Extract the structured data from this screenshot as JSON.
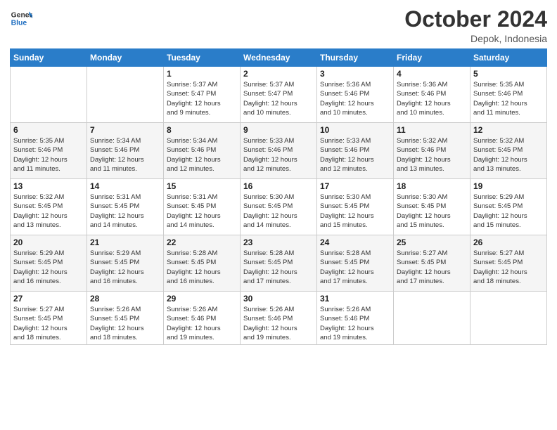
{
  "logo": {
    "line1": "General",
    "line2": "Blue"
  },
  "title": "October 2024",
  "location": "Depok, Indonesia",
  "days_header": [
    "Sunday",
    "Monday",
    "Tuesday",
    "Wednesday",
    "Thursday",
    "Friday",
    "Saturday"
  ],
  "weeks": [
    [
      {
        "day": "",
        "info": ""
      },
      {
        "day": "",
        "info": ""
      },
      {
        "day": "1",
        "info": "Sunrise: 5:37 AM\nSunset: 5:47 PM\nDaylight: 12 hours\nand 9 minutes."
      },
      {
        "day": "2",
        "info": "Sunrise: 5:37 AM\nSunset: 5:47 PM\nDaylight: 12 hours\nand 10 minutes."
      },
      {
        "day": "3",
        "info": "Sunrise: 5:36 AM\nSunset: 5:46 PM\nDaylight: 12 hours\nand 10 minutes."
      },
      {
        "day": "4",
        "info": "Sunrise: 5:36 AM\nSunset: 5:46 PM\nDaylight: 12 hours\nand 10 minutes."
      },
      {
        "day": "5",
        "info": "Sunrise: 5:35 AM\nSunset: 5:46 PM\nDaylight: 12 hours\nand 11 minutes."
      }
    ],
    [
      {
        "day": "6",
        "info": "Sunrise: 5:35 AM\nSunset: 5:46 PM\nDaylight: 12 hours\nand 11 minutes."
      },
      {
        "day": "7",
        "info": "Sunrise: 5:34 AM\nSunset: 5:46 PM\nDaylight: 12 hours\nand 11 minutes."
      },
      {
        "day": "8",
        "info": "Sunrise: 5:34 AM\nSunset: 5:46 PM\nDaylight: 12 hours\nand 12 minutes."
      },
      {
        "day": "9",
        "info": "Sunrise: 5:33 AM\nSunset: 5:46 PM\nDaylight: 12 hours\nand 12 minutes."
      },
      {
        "day": "10",
        "info": "Sunrise: 5:33 AM\nSunset: 5:46 PM\nDaylight: 12 hours\nand 12 minutes."
      },
      {
        "day": "11",
        "info": "Sunrise: 5:32 AM\nSunset: 5:46 PM\nDaylight: 12 hours\nand 13 minutes."
      },
      {
        "day": "12",
        "info": "Sunrise: 5:32 AM\nSunset: 5:45 PM\nDaylight: 12 hours\nand 13 minutes."
      }
    ],
    [
      {
        "day": "13",
        "info": "Sunrise: 5:32 AM\nSunset: 5:45 PM\nDaylight: 12 hours\nand 13 minutes."
      },
      {
        "day": "14",
        "info": "Sunrise: 5:31 AM\nSunset: 5:45 PM\nDaylight: 12 hours\nand 14 minutes."
      },
      {
        "day": "15",
        "info": "Sunrise: 5:31 AM\nSunset: 5:45 PM\nDaylight: 12 hours\nand 14 minutes."
      },
      {
        "day": "16",
        "info": "Sunrise: 5:30 AM\nSunset: 5:45 PM\nDaylight: 12 hours\nand 14 minutes."
      },
      {
        "day": "17",
        "info": "Sunrise: 5:30 AM\nSunset: 5:45 PM\nDaylight: 12 hours\nand 15 minutes."
      },
      {
        "day": "18",
        "info": "Sunrise: 5:30 AM\nSunset: 5:45 PM\nDaylight: 12 hours\nand 15 minutes."
      },
      {
        "day": "19",
        "info": "Sunrise: 5:29 AM\nSunset: 5:45 PM\nDaylight: 12 hours\nand 15 minutes."
      }
    ],
    [
      {
        "day": "20",
        "info": "Sunrise: 5:29 AM\nSunset: 5:45 PM\nDaylight: 12 hours\nand 16 minutes."
      },
      {
        "day": "21",
        "info": "Sunrise: 5:29 AM\nSunset: 5:45 PM\nDaylight: 12 hours\nand 16 minutes."
      },
      {
        "day": "22",
        "info": "Sunrise: 5:28 AM\nSunset: 5:45 PM\nDaylight: 12 hours\nand 16 minutes."
      },
      {
        "day": "23",
        "info": "Sunrise: 5:28 AM\nSunset: 5:45 PM\nDaylight: 12 hours\nand 17 minutes."
      },
      {
        "day": "24",
        "info": "Sunrise: 5:28 AM\nSunset: 5:45 PM\nDaylight: 12 hours\nand 17 minutes."
      },
      {
        "day": "25",
        "info": "Sunrise: 5:27 AM\nSunset: 5:45 PM\nDaylight: 12 hours\nand 17 minutes."
      },
      {
        "day": "26",
        "info": "Sunrise: 5:27 AM\nSunset: 5:45 PM\nDaylight: 12 hours\nand 18 minutes."
      }
    ],
    [
      {
        "day": "27",
        "info": "Sunrise: 5:27 AM\nSunset: 5:45 PM\nDaylight: 12 hours\nand 18 minutes."
      },
      {
        "day": "28",
        "info": "Sunrise: 5:26 AM\nSunset: 5:45 PM\nDaylight: 12 hours\nand 18 minutes."
      },
      {
        "day": "29",
        "info": "Sunrise: 5:26 AM\nSunset: 5:46 PM\nDaylight: 12 hours\nand 19 minutes."
      },
      {
        "day": "30",
        "info": "Sunrise: 5:26 AM\nSunset: 5:46 PM\nDaylight: 12 hours\nand 19 minutes."
      },
      {
        "day": "31",
        "info": "Sunrise: 5:26 AM\nSunset: 5:46 PM\nDaylight: 12 hours\nand 19 minutes."
      },
      {
        "day": "",
        "info": ""
      },
      {
        "day": "",
        "info": ""
      }
    ]
  ]
}
